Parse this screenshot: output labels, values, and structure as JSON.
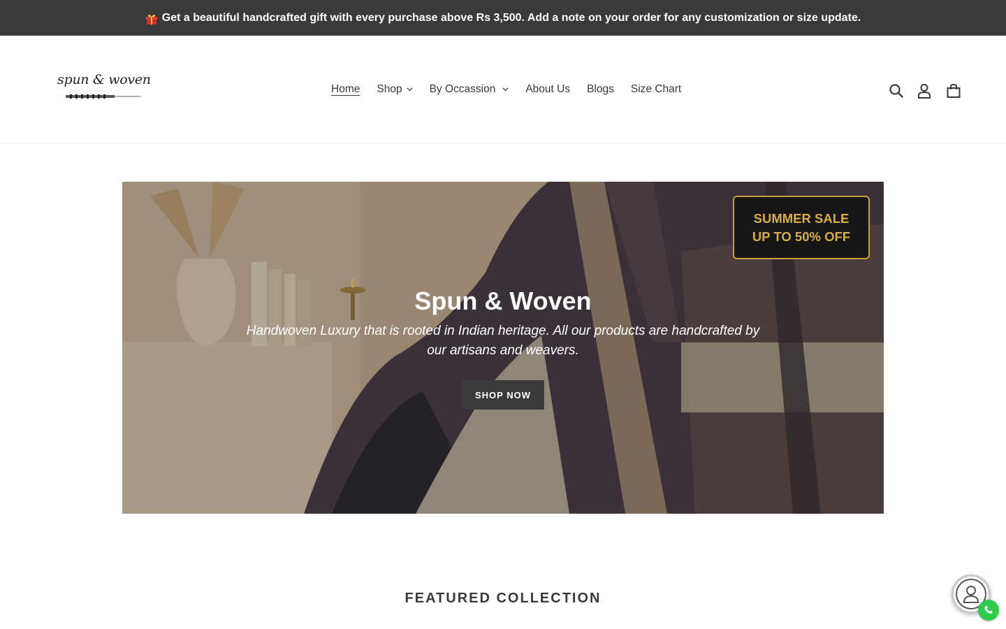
{
  "announcement": {
    "icon": "gift-icon",
    "text": "Get a beautiful handcrafted gift with every purchase above Rs 3,500. Add a note on your order for any customization or size update."
  },
  "header": {
    "logo_text": "spun & woven",
    "nav": [
      {
        "label": "Home",
        "active": true,
        "dropdown": false
      },
      {
        "label": "Shop",
        "active": false,
        "dropdown": true
      },
      {
        "label": "By Occassion",
        "active": false,
        "dropdown": true
      },
      {
        "label": "About Us",
        "active": false,
        "dropdown": false
      },
      {
        "label": "Blogs",
        "active": false,
        "dropdown": false
      },
      {
        "label": "Size Chart",
        "active": false,
        "dropdown": false
      }
    ],
    "icons": [
      "search-icon",
      "account-icon",
      "cart-icon"
    ]
  },
  "hero": {
    "badge_line1": "SUMMER SALE",
    "badge_line2": "UP TO 50% OFF",
    "title": "Spun & Woven",
    "subtitle": "Handwoven Luxury that is rooted in Indian heritage. All our products are handcrafted by our artisans and weavers.",
    "cta_label": "SHOP NOW"
  },
  "featured": {
    "heading": "FEATURED COLLECTION"
  },
  "colors": {
    "announcement_bg": "#3a3a3a",
    "text": "#3a3a3a",
    "badge_gold": "#d9ad45",
    "whatsapp_green": "#2ecc4a"
  }
}
